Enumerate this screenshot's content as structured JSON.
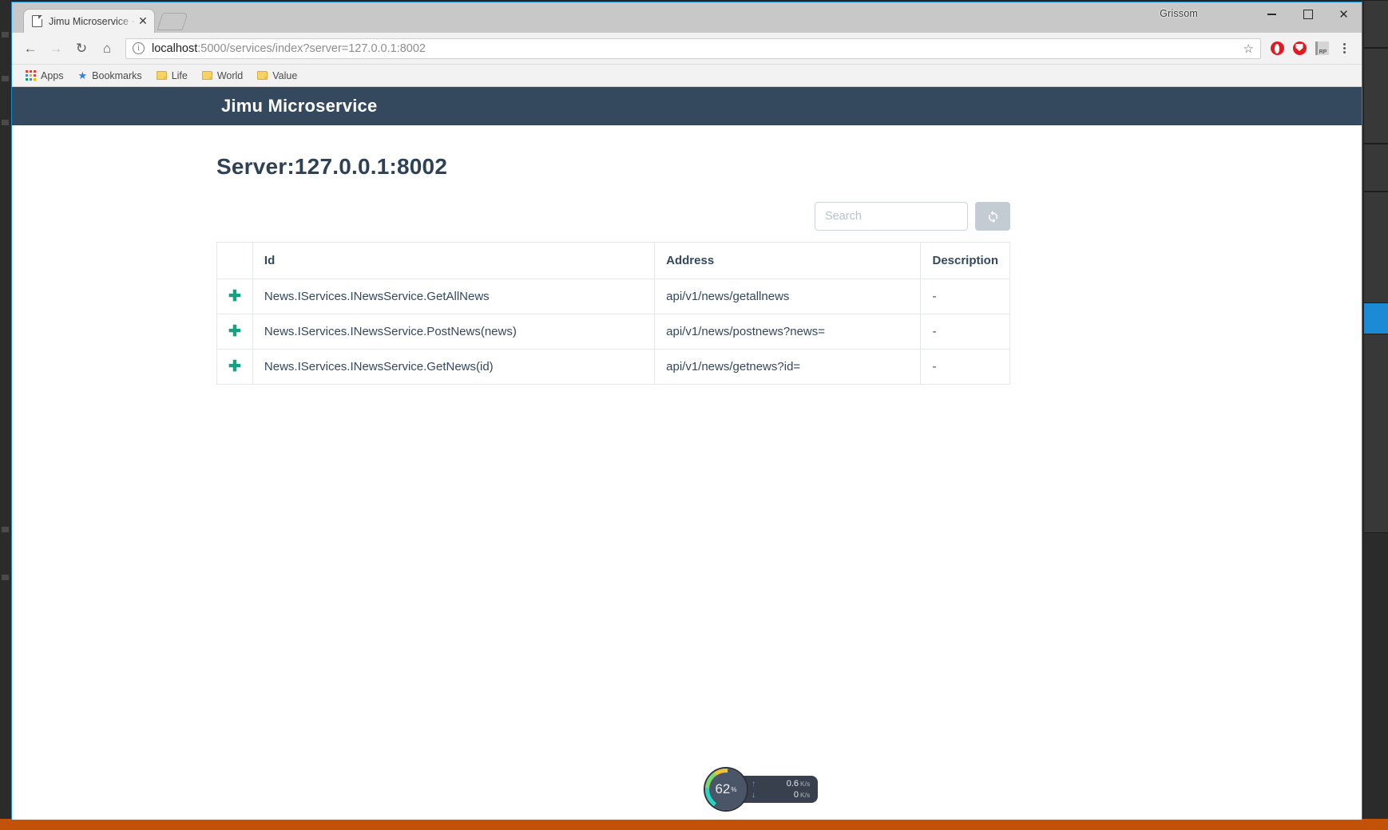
{
  "window": {
    "user_label": "Grissom",
    "minimize_icon": "minimize-icon",
    "maximize_icon": "maximize-icon",
    "close_label": "✕"
  },
  "tab": {
    "title": "Jimu Microservice - Ser",
    "close_label": "✕"
  },
  "omnibox": {
    "url_host": "localhost",
    "url_path": ":5000/services/index?server=127.0.0.1:8002",
    "star_label": "☆",
    "back_label": "←",
    "forward_label": "→",
    "reload_label": "↻",
    "home_label": "⌂",
    "info_label": "i",
    "extensions": [
      {
        "name": "opera-vpn-icon",
        "label": ""
      },
      {
        "name": "adblock-shield-icon",
        "label": ""
      },
      {
        "name": "requestpolicy-icon",
        "label": "RP"
      }
    ]
  },
  "bookmarks": [
    {
      "label": "Apps",
      "icon": "apps-grid-icon"
    },
    {
      "label": "Bookmarks",
      "icon": "star-icon"
    },
    {
      "label": "Life",
      "icon": "folder-icon"
    },
    {
      "label": "World",
      "icon": "folder-icon"
    },
    {
      "label": "Value",
      "icon": "folder-icon"
    }
  ],
  "app": {
    "brand": "Jimu Microservice",
    "page_title": "Server:127.0.0.1:8002",
    "navbar_color": "#34495e",
    "accent_color": "#18a085"
  },
  "toolbar": {
    "search_placeholder": "Search",
    "search_value": "",
    "refresh_icon": "refresh-icon"
  },
  "table": {
    "headers": [
      "",
      "Id",
      "Address",
      "Description"
    ],
    "expand_icon": "plus-icon",
    "rows": [
      {
        "expand": "✚",
        "id": "News.IServices.INewsService.GetAllNews",
        "address": "api/v1/news/getallnews",
        "description": "-"
      },
      {
        "expand": "✚",
        "id": "News.IServices.INewsService.PostNews(news)",
        "address": "api/v1/news/postnews?news=",
        "description": "-"
      },
      {
        "expand": "✚",
        "id": "News.IServices.INewsService.GetNews(id)",
        "address": "api/v1/news/getnews?id=",
        "description": "-"
      }
    ]
  },
  "sysmon": {
    "cpu_percent": "62",
    "cpu_unit": "%",
    "upload_arrow": "↑",
    "upload_value": "0.6",
    "upload_unit": "K/s",
    "download_arrow": "↓",
    "download_value": "0",
    "download_unit": "K/s"
  }
}
